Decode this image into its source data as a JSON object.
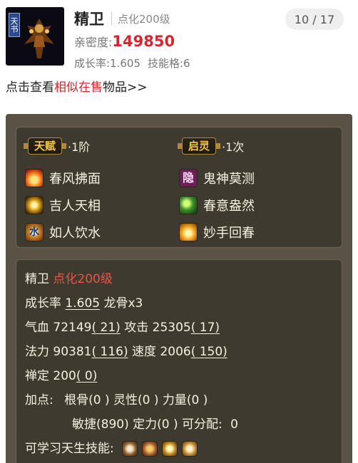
{
  "header": {
    "avatar_tag": "天书",
    "pet_name": "精卫",
    "level_tag": "点化200级",
    "page_counter": "10 / 17",
    "intimacy_label": "亲密度:",
    "intimacy_value": "149850",
    "growth_text": "成长率:1.605",
    "skill_slots_text": "技能格:6",
    "similar_prefix": "点击查看",
    "similar_highlight": "相似在售",
    "similar_suffix": "物品>>"
  },
  "tianfu": {
    "badge_left": "天赋",
    "badge_left_suffix": "·1阶",
    "badge_right": "启灵",
    "badge_right_suffix": "·1次",
    "skills": [
      {
        "label": "春风拂面",
        "icon": "fire-skill-icon"
      },
      {
        "label": "鬼神莫测",
        "icon": "yin-skill-icon",
        "glyph": "隐"
      },
      {
        "label": "吉人天相",
        "icon": "gold-skill-icon"
      },
      {
        "label": "春意盎然",
        "icon": "spring-skill-icon"
      },
      {
        "label": "如人饮水",
        "icon": "water-skill-icon",
        "glyph": "水"
      },
      {
        "label": "妙手回春",
        "icon": "hand-skill-icon"
      }
    ]
  },
  "stats": {
    "name": "精卫",
    "level": "点化200级",
    "growth_label": "成长率",
    "growth_value": "1.605",
    "dragon_bone": "龙骨x3",
    "hp_label": "气血",
    "hp_value": "72149",
    "hp_bonus": "( 21)",
    "atk_label": "攻击",
    "atk_value": "25305",
    "atk_bonus": "( 17)",
    "mp_label": "法力",
    "mp_value": "90381",
    "mp_bonus": "( 116)",
    "spd_label": "速度",
    "spd_value": "2006",
    "spd_bonus": "( 150)",
    "zen_label": "禅定",
    "zen_value": "200",
    "zen_bonus": "( 0)",
    "points_label": "加点:",
    "points_line1": "根骨(0 ) 灵性(0 ) 力量(0 )",
    "points_line2": "敏捷(890) 定力(0 ) 可分配:",
    "points_free": "0",
    "learnable_label": "可学习天生技能:"
  },
  "colors": {
    "accent_red": "#d7262f",
    "green_stat": "#7ed957",
    "orange_label": "#e9b55a",
    "badge_gold": "#f2c64b"
  }
}
